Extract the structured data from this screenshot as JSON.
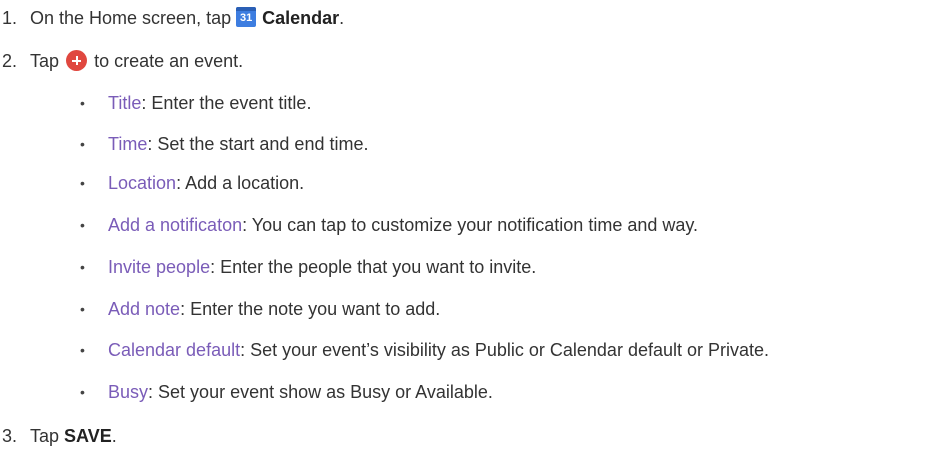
{
  "steps": [
    {
      "number": "1.",
      "pre": "On the Home screen, tap",
      "icon": "calendar-icon",
      "icon_text": "31",
      "bold": "Calendar",
      "post": "."
    },
    {
      "number": "2.",
      "pre": "Tap",
      "icon": "plus-icon",
      "post": "to create an event."
    },
    {
      "number": "3.",
      "pre": "Tap",
      "bold": "SAVE",
      "post": "."
    }
  ],
  "items": [
    {
      "term": "Title",
      "desc": ": Enter the event title."
    },
    {
      "term": "Time",
      "desc": ": Set the start and end time."
    },
    {
      "term": "Location",
      "desc": ": Add a location."
    },
    {
      "term": "Add a notificaton",
      "desc": ": You can tap to customize your notification time and way."
    },
    {
      "term": "Invite people",
      "desc": ": Enter the people that you want to invite."
    },
    {
      "term": "Add note",
      "desc": ": Enter the note you want to add."
    },
    {
      "term": "Calendar default",
      "desc": ": Set your event’s visibility as Public or Calendar default or Private."
    },
    {
      "term": "Busy",
      "desc": ": Set your event show as Busy or Available."
    }
  ],
  "bullet_char": "•",
  "colors": {
    "term": "#7a5cb8",
    "calendar_icon": "#3d7de0",
    "plus_icon": "#e0473f",
    "text": "#333333"
  }
}
